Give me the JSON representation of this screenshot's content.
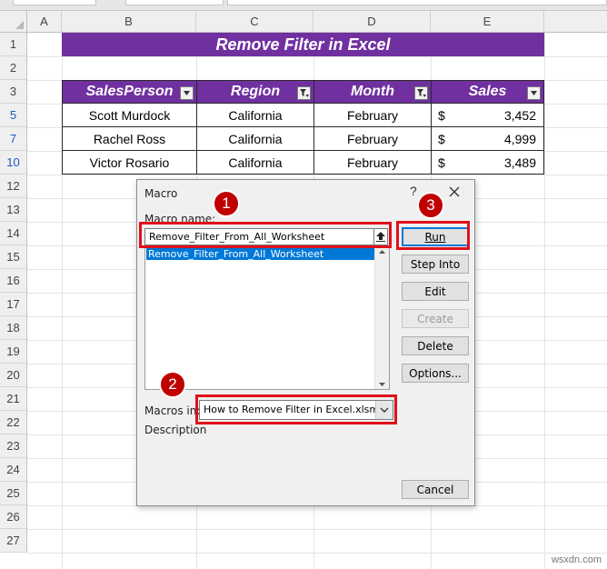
{
  "columns": [
    "A",
    "B",
    "C",
    "D",
    "E"
  ],
  "rows": [
    "1",
    "2",
    "3",
    "5",
    "7",
    "10",
    "12",
    "13",
    "14",
    "15",
    "16",
    "17",
    "18",
    "19",
    "20",
    "21",
    "22",
    "23",
    "24",
    "25",
    "26",
    "27"
  ],
  "filtered_rows": [
    "5",
    "7",
    "10"
  ],
  "sheet_title": "Remove Filter in Excel",
  "table": {
    "headers": [
      "SalesPerson",
      "Region",
      "Month",
      "Sales"
    ],
    "filter_icons": [
      "dropdown-filter-icon",
      "active-filter-icon",
      "active-filter-icon",
      "dropdown-filter-icon"
    ],
    "rows": [
      {
        "salesperson": "Scott Murdock",
        "region": "California",
        "month": "February",
        "currency": "$",
        "sales": "3,452"
      },
      {
        "salesperson": "Rachel Ross",
        "region": "California",
        "month": "February",
        "currency": "$",
        "sales": "4,999"
      },
      {
        "salesperson": "Victor Rosario",
        "region": "California",
        "month": "February",
        "currency": "$",
        "sales": "3,489"
      }
    ]
  },
  "dialog": {
    "title": "Macro",
    "help": "?",
    "macro_name_label": "Macro name:",
    "macro_name_value": "Remove_Filter_From_All_Worksheet",
    "list_items": [
      "Remove_Filter_From_All_Worksheet"
    ],
    "buttons": {
      "run": "Run",
      "step_into": "Step Into",
      "edit": "Edit",
      "create": "Create",
      "delete": "Delete",
      "options": "Options...",
      "cancel": "Cancel"
    },
    "macros_in_label": "Macros in:",
    "macros_in_value": "How to Remove Filter in Excel.xlsm",
    "description_label": "Description"
  },
  "callouts": [
    "1",
    "2",
    "3"
  ],
  "colors": {
    "accent_purple": "#7030a0",
    "callout_red": "#e0101a",
    "selection_blue": "#0078d7"
  },
  "watermark": "wsxdn.com"
}
